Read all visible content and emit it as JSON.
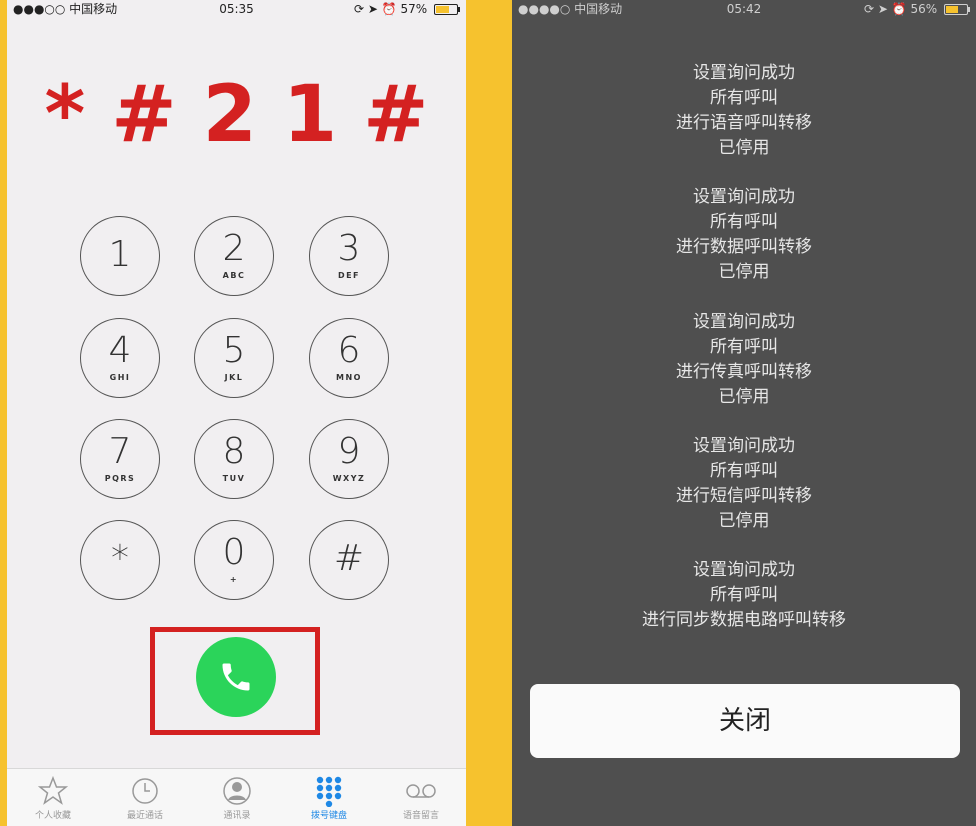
{
  "left": {
    "status": {
      "carrier": "●●●○○ 中国移动",
      "time": "05:35",
      "battery": "57%",
      "battery_level": 0.57
    },
    "code": "*#21#",
    "keys": [
      {
        "num": "1",
        "letters": ""
      },
      {
        "num": "2",
        "letters": "ABC"
      },
      {
        "num": "3",
        "letters": "DEF"
      },
      {
        "num": "4",
        "letters": "GHI"
      },
      {
        "num": "5",
        "letters": "JKL"
      },
      {
        "num": "6",
        "letters": "MNO"
      },
      {
        "num": "7",
        "letters": "PQRS"
      },
      {
        "num": "8",
        "letters": "TUV"
      },
      {
        "num": "9",
        "letters": "WXYZ"
      },
      {
        "num": "*",
        "letters": ""
      },
      {
        "num": "0",
        "letters": "+"
      },
      {
        "num": "#",
        "letters": ""
      }
    ],
    "tabs": [
      {
        "label": "个人收藏",
        "icon": "star-icon"
      },
      {
        "label": "最近通话",
        "icon": "clock-icon"
      },
      {
        "label": "通讯录",
        "icon": "contact-icon"
      },
      {
        "label": "拨号键盘",
        "icon": "keypad-icon",
        "active": true
      },
      {
        "label": "语音留言",
        "icon": "voicemail-icon"
      }
    ],
    "accent": "#d42121",
    "call_color": "#2bd45a",
    "active_tab_color": "#1e88e5"
  },
  "right": {
    "status": {
      "carrier": "●●●●○ 中国移动",
      "time": "05:42",
      "battery": "56%",
      "battery_level": 0.56
    },
    "messages": [
      [
        "设置询问成功",
        "所有呼叫",
        "进行语音呼叫转移",
        "已停用"
      ],
      [
        "设置询问成功",
        "所有呼叫",
        "进行数据呼叫转移",
        "已停用"
      ],
      [
        "设置询问成功",
        "所有呼叫",
        "进行传真呼叫转移",
        "已停用"
      ],
      [
        "设置询问成功",
        "所有呼叫",
        "进行短信呼叫转移",
        "已停用"
      ],
      [
        "设置询问成功",
        "所有呼叫",
        "进行同步数据电路呼叫转移"
      ]
    ],
    "close_label": "关闭"
  }
}
